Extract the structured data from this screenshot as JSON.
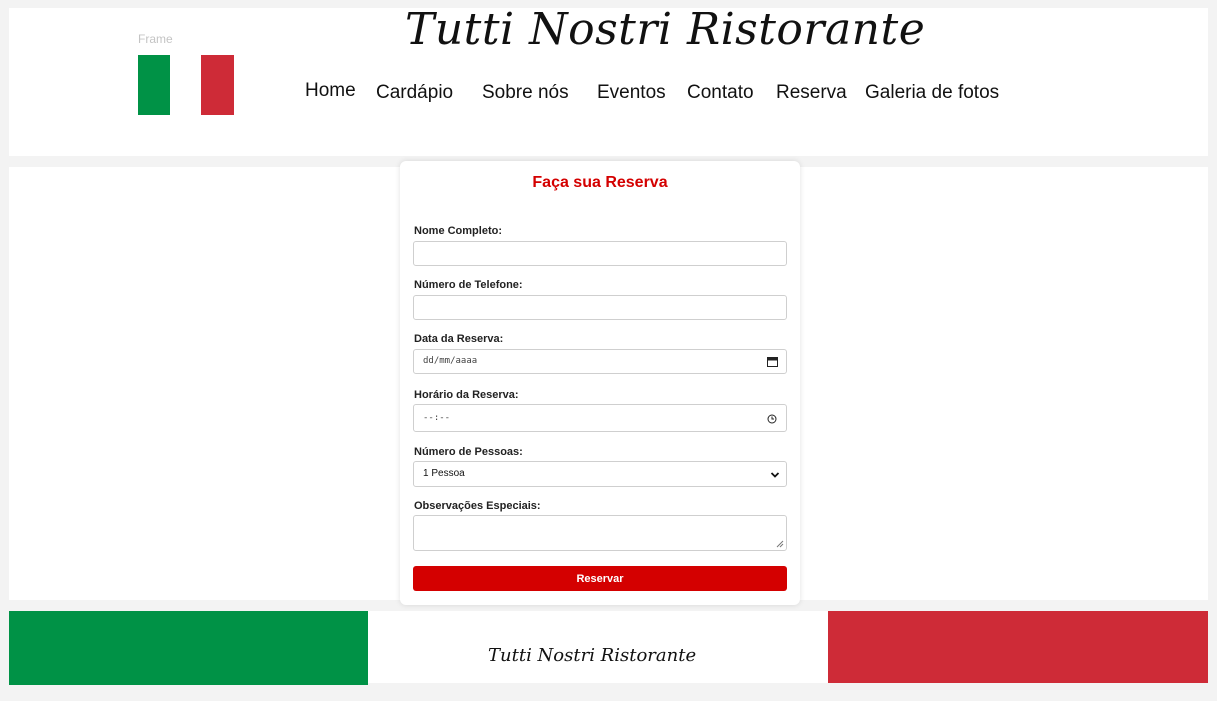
{
  "header": {
    "frame_label": "Frame",
    "brand": "Tutti Nostri Ristorante",
    "nav": [
      "Home",
      "Cardápio",
      "Sobre nós",
      "Eventos",
      "Contato",
      "Reserva",
      "Galeria de fotos"
    ]
  },
  "form": {
    "title": "Faça sua Reserva",
    "name_label": "Nome Completo:",
    "phone_label": "Número de Telefone:",
    "date_label": "Data da Reserva:",
    "date_placeholder": "dd/mm/aaaa",
    "time_label": "Horário da Reserva:",
    "time_placeholder": "--:--",
    "people_label": "Número de Pessoas:",
    "people_selected": "1 Pessoa",
    "notes_label": "Observações Especiais:",
    "submit_label": "Reservar"
  },
  "footer": {
    "brand": "Tutti Nostri Ristorante"
  },
  "colors": {
    "green": "#009246",
    "red": "#ce2b37",
    "accent": "#d40000"
  }
}
